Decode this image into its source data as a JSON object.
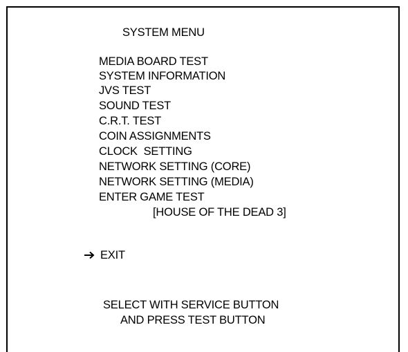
{
  "title": "SYSTEM MENU",
  "menu_items": [
    "MEDIA BOARD TEST",
    "SYSTEM INFORMATION",
    "JVS TEST",
    "SOUND TEST",
    "C.R.T. TEST",
    "COIN ASSIGNMENTS",
    "CLOCK  SETTING",
    "NETWORK SETTING (CORE)",
    "NETWORK SETTING (MEDIA)",
    "ENTER GAME TEST"
  ],
  "game_name": "[HOUSE OF THE DEAD 3]",
  "exit_label": "EXIT",
  "selected_item": "EXIT",
  "cursor_icon": "right-arrow-icon",
  "instructions": [
    "SELECT WITH SERVICE BUTTON",
    "AND PRESS TEST BUTTON"
  ]
}
